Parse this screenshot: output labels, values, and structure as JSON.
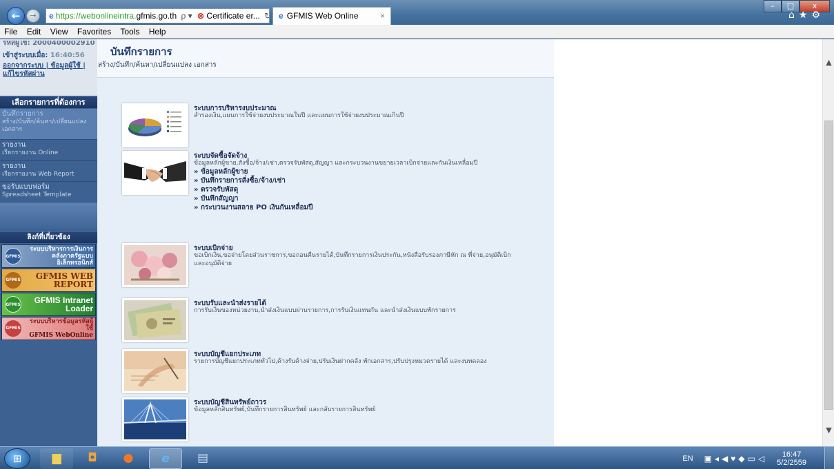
{
  "browser": {
    "address_prefix": "https://webonlineintra.",
    "address_host": "gfmis.go.th",
    "address_tools": "ρ ▾",
    "cert_text": "Certificate er...",
    "refresh_icon": "↻",
    "tab_title": "GFMIS Web Online",
    "tab_close": "×",
    "toolbar_icons": "⌂★⚙",
    "window_controls": [
      "–",
      "□",
      "x"
    ]
  },
  "menu_bar": [
    "File",
    "Edit",
    "View",
    "Favorites",
    "Tools",
    "Help"
  ],
  "sidebar": {
    "user_id": "รหัสผู้ใช้: 2000400002910",
    "login_label": "เข้าสู่ระบบเมื่อ:",
    "login_time": "16:40:56",
    "logout_links": "ออกจากระบบ | ข้อมูลผู้ใช้ | แก้ไขรหัสผ่าน",
    "menu_header": "เลือกรายการที่ต้องการ",
    "items": [
      {
        "title": "บันทึกรายการ",
        "sub": "สร้าง/บันทึก/ค้นหา/เปลี่ยนแปลง เอกสาร"
      },
      {
        "title": "รายงาน",
        "sub": "เรียกรายงาน Online"
      },
      {
        "title": "รายงาน",
        "sub": "เรียกรายงาน Web Report"
      },
      {
        "title": "ขอรับแบบฟอร์ม",
        "sub": "Spreadsheet Template"
      }
    ],
    "links_header": "ลิงก์ที่เกี่ยวข้อง",
    "banners": [
      {
        "logo": "GFMIS",
        "text": "ระบบบริหารการเงินการคลังภาครัฐแบบอิเล็กทรอนิกส์"
      },
      {
        "logo": "GFMIS",
        "text": "GFMIS WEB REPORT"
      },
      {
        "logo": "GFMIS",
        "text": "GFMIS Intranet Loader"
      },
      {
        "logo": "GFMIS",
        "text": "ระบบบริหารข้อมูลรหัสผู้ใช้",
        "text_bold": "GFMIS WebOnline"
      }
    ]
  },
  "main": {
    "title": "บันทึกรายการ",
    "subtitle": "สร้าง/บันทึก/ค้นหา/เปลี่ยนแปลง เอกสาร",
    "services": [
      {
        "title": "ระบบการบริหารงบประมาณ",
        "desc": "สำรองเงิน,แผนการใช้จ่ายงบประมาณในปี และแผนการใช้จ่ายงบประมาณเกินปี",
        "links": []
      },
      {
        "title": "ระบบจัดซื้อจัดจ้าง",
        "desc": "ข้อมูลหลักผู้ขาย,สั่งซื้อ/จ้าง/เช่า,ตรวจรับพัสดุ,สัญญา และกระบวนงานขยายเวลาเบิกจ่ายและกันเงินเหลื่อมปี",
        "links": [
          "» ข้อมูลหลักผู้ขาย",
          "» บันทึกรายการสั่งซื้อ/จ้าง/เช่า",
          "» ตรวจรับพัสดุ",
          "» บันทึกสัญญา",
          "» กระบวนงานสลาย PO เงินกันเหลื่อมปี"
        ]
      },
      {
        "title": "ระบบเบิกจ่าย",
        "desc": "ขอเบิกเงิน,ขอจ่ายโดยส่วนราชการ,ขอถอนคืนรายได้,บันทึกรายการเงินประกัน,หนังสือรับรองภาษีหัก ณ ที่จ่าย,อนุมัติเบิก และอนุมัติจ่าย",
        "links": []
      },
      {
        "title": "ระบบรับและนำส่งรายได้",
        "desc": "การรับเงินของหน่วยงาน,นำส่งเงินแบบผ่านรายการ,การรับเงินแทนกัน และนำส่งเงินแบบพักรายการ",
        "links": []
      },
      {
        "title": "ระบบบัญชีแยกประเภท",
        "desc": "รายการบัญชีแยกประเภททั่วไป,ค้างรับค้างจ่าย,ปรับเงินฝากคลัง พักเอกสาร,ปรับปรุงหมวดรายได้ และงบทดลอง",
        "links": []
      },
      {
        "title": "ระบบบัญชีสินทรัพย์ถาวร",
        "desc": "ข้อมูลหลักสินทรัพย์,บันทึกรายการสินทรัพย์ และกลับรายการสินทรัพย์",
        "links": []
      }
    ]
  },
  "taskbar": {
    "start_glyph": "⊞",
    "language": "EN",
    "tray_icons": "▣◂◀♥◆▭◁",
    "clock_time": "16:47",
    "clock_date": "5/2/2559"
  },
  "colors": {
    "sidebar_bg": "#3d6191",
    "content_bg": "#e6eef7",
    "title_color": "#1f3f75",
    "accent_header": "#1b3560"
  }
}
